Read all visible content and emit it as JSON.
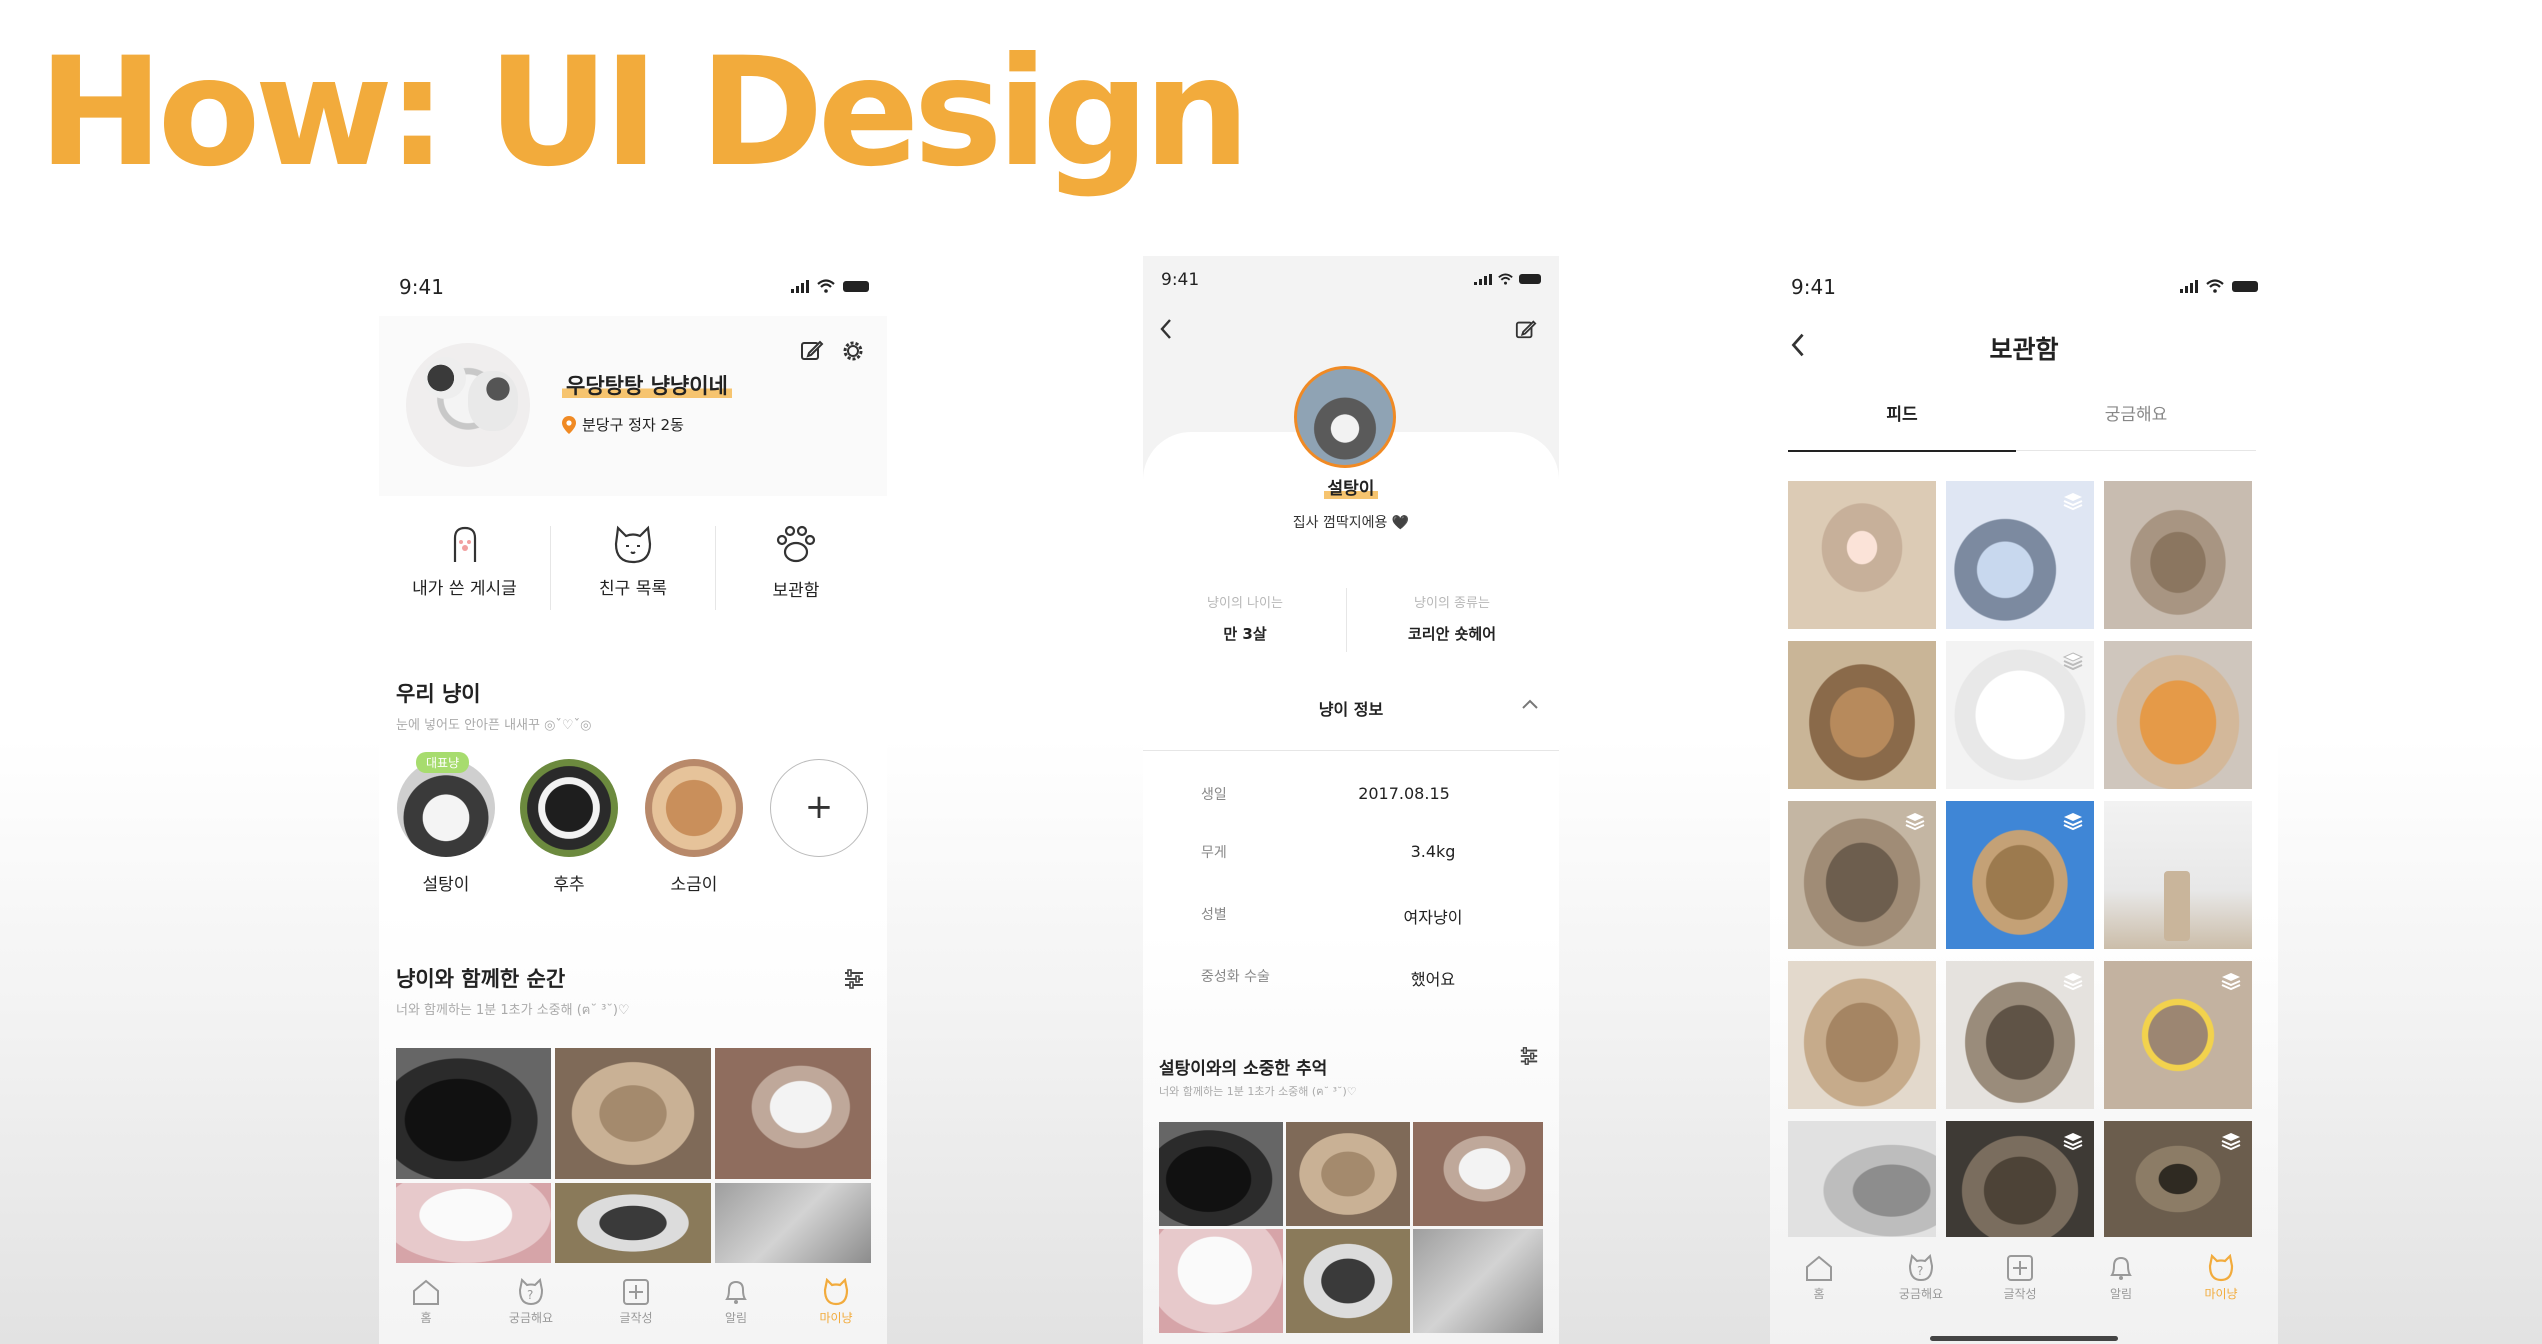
{
  "slide": {
    "title": "How: UI Design"
  },
  "screen1": {
    "status_time": "9:41",
    "profile": {
      "name": "우당탕탕 냥냥이네",
      "location": "분당구 정자 2동"
    },
    "menu": [
      {
        "label": "내가 쓴 게시글",
        "icon": "cat-paw-icon"
      },
      {
        "label": "친구 목록",
        "icon": "cat-face-icon"
      },
      {
        "label": "보관함",
        "icon": "paw-print-icon"
      }
    ],
    "our_cats": {
      "title": "우리 냥이",
      "subtitle": "눈에 넣어도 안아픈 내새꾸 ◎ˇ♡ˇ◎",
      "badge": "대표냥",
      "cats": [
        "설탕이",
        "후추",
        "소금이"
      ]
    },
    "moments": {
      "title": "냥이와 함께한 순간",
      "subtitle": "너와 함께하는 1분 1초가 소중해 (ฅ˘ ³˘)♡"
    },
    "nav": [
      "홈",
      "궁금해요",
      "글작성",
      "알림",
      "마이냥"
    ]
  },
  "screen2": {
    "status_time": "9:41",
    "cat_name": "설탕이",
    "owner_line": "집사 껌딱지에용 🖤",
    "stats": [
      {
        "label": "냥이의 나이는",
        "value": "만 3살"
      },
      {
        "label": "냥이의 종류는",
        "value": "코리안 숏헤어"
      }
    ],
    "info_title": "냥이 정보",
    "info": [
      {
        "label": "생일",
        "value": "2017.08.15"
      },
      {
        "label": "무게",
        "value": "3.4kg"
      },
      {
        "label": "성별",
        "value": "여자냥이"
      },
      {
        "label": "중성화 수술",
        "value": "했어요"
      }
    ],
    "memories": {
      "title": "설탕이와의 소중한 추억",
      "subtitle": "너와 함께하는 1분 1초가 소중해 (ฅ˘ ³˘)♡"
    }
  },
  "screen3": {
    "status_time": "9:41",
    "title": "보관함",
    "tabs": [
      "피드",
      "궁금해요"
    ],
    "nav": [
      "홈",
      "궁금해요",
      "글작성",
      "알림",
      "마이냥"
    ]
  },
  "colors": {
    "accent": "#f2ab3c",
    "text": "#222222",
    "muted": "#999999"
  }
}
